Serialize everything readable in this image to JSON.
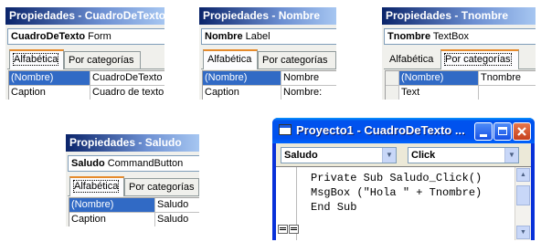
{
  "panels": {
    "cuadro": {
      "title": "Propiedades - CuadroDeTexto",
      "object_name": "CuadroDeTexto",
      "object_type": "Form",
      "tabs": [
        "Alfabética",
        "Por categorías"
      ],
      "rows": [
        {
          "name": "(Nombre)",
          "value": "CuadroDeTexto"
        },
        {
          "name": "Caption",
          "value": "Cuadro de texto"
        }
      ]
    },
    "nombre": {
      "title": "Propiedades - Nombre",
      "object_name": "Nombre",
      "object_type": "Label",
      "tabs": [
        "Alfabética",
        "Por categorías"
      ],
      "rows": [
        {
          "name": "(Nombre)",
          "value": "Nombre"
        },
        {
          "name": "Caption",
          "value": "Nombre:"
        }
      ]
    },
    "tnombre": {
      "title": "Propiedades - Tnombre",
      "object_name": "Tnombre",
      "object_type": "TextBox",
      "tabs": [
        "Alfabética",
        "Por categorías"
      ],
      "rows": [
        {
          "name": "(Nombre)",
          "value": "Tnombre"
        },
        {
          "name": "Text",
          "value": ""
        }
      ]
    },
    "saludo": {
      "title": "Propiedades - Saludo",
      "object_name": "Saludo",
      "object_type": "CommandButton",
      "tabs": [
        "Alfabética",
        "Por categorías"
      ],
      "rows": [
        {
          "name": "(Nombre)",
          "value": "Saludo"
        },
        {
          "name": "Caption",
          "value": "Saludo"
        }
      ]
    }
  },
  "code_window": {
    "title": "Proyecto1 - CuadroDeTexto ...",
    "object_dropdown": "Saludo",
    "procedure_dropdown": "Click",
    "code_lines": [
      "Private Sub Saludo_Click()",
      "MsgBox (\"Hola \" + Tnombre)",
      "End Sub"
    ],
    "icons": {
      "window": "form-window-icon",
      "minimize": "minimize-icon",
      "maximize": "maximize-icon",
      "close": "close-icon"
    }
  },
  "colors": {
    "selection": "#316ac5",
    "active_tab_accent": "#e68b2c",
    "xp_titlebar": "#0050ee"
  }
}
